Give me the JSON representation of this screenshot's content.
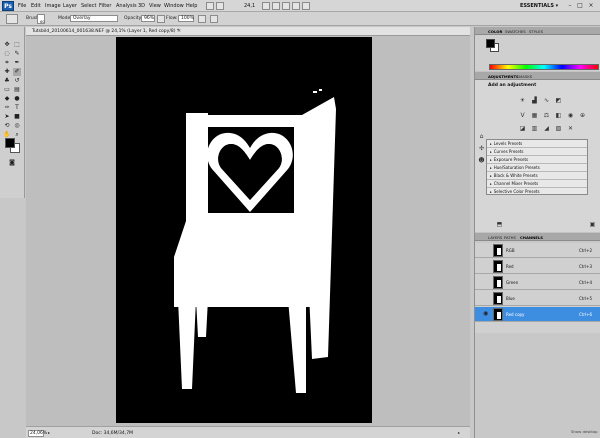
{
  "app": {
    "logo": "Ps",
    "zoom_readout": "24,1",
    "workspace": "ESSENTIALS ▾"
  },
  "menu": [
    "File",
    "Edit",
    "Image",
    "Layer",
    "Select",
    "Filter",
    "Analysis",
    "3D",
    "View",
    "Window",
    "Help"
  ],
  "window_controls": {
    "minimize": "–",
    "maximize": "□",
    "close": "×"
  },
  "options": {
    "brush_label": "Brush:",
    "brush_size": "60",
    "mode_label": "Mode:",
    "mode_value": "Overlay",
    "opacity_label": "Opacity:",
    "opacity_value": "96%",
    "flow_label": "Flow:",
    "flow_value": "100%"
  },
  "document": {
    "tab_title": "Tutsbild_20100614_001638.NEF @ 24,1% (Layer 1, Red copy/8) *",
    "close": "×",
    "zoom": "24,06%",
    "doc_size": "Doc: 34,6M/34,7M"
  },
  "color_panel": {
    "tabs": [
      "COLOR",
      "SWATCHES",
      "STYLES"
    ]
  },
  "adjustments_panel": {
    "tabs": [
      "ADJUSTMENTS",
      "MASKS"
    ],
    "title": "Add an adjustment",
    "presets": [
      "Levels Presets",
      "Curves Presets",
      "Exposure Presets",
      "Hue/Saturation Presets",
      "Black & White Presets",
      "Channel Mixer Presets",
      "Selective Color Presets"
    ]
  },
  "layers_panel": {
    "tabs": [
      "LAYERS",
      "PATHS",
      "CHANNELS"
    ],
    "channels": [
      {
        "name": "RGB",
        "shortcut": "Ctrl+2",
        "visible": false,
        "selected": false
      },
      {
        "name": "Red",
        "shortcut": "Ctrl+3",
        "visible": false,
        "selected": false
      },
      {
        "name": "Green",
        "shortcut": "Ctrl+4",
        "visible": false,
        "selected": false
      },
      {
        "name": "Blue",
        "shortcut": "Ctrl+5",
        "visible": false,
        "selected": false
      },
      {
        "name": "Red copy",
        "shortcut": "Ctrl+6",
        "visible": true,
        "selected": true
      }
    ],
    "footer": "Show desktop"
  },
  "colors": {
    "selection": "#3d8ee0",
    "canvas": "#000000",
    "artwork": "#ffffff"
  }
}
